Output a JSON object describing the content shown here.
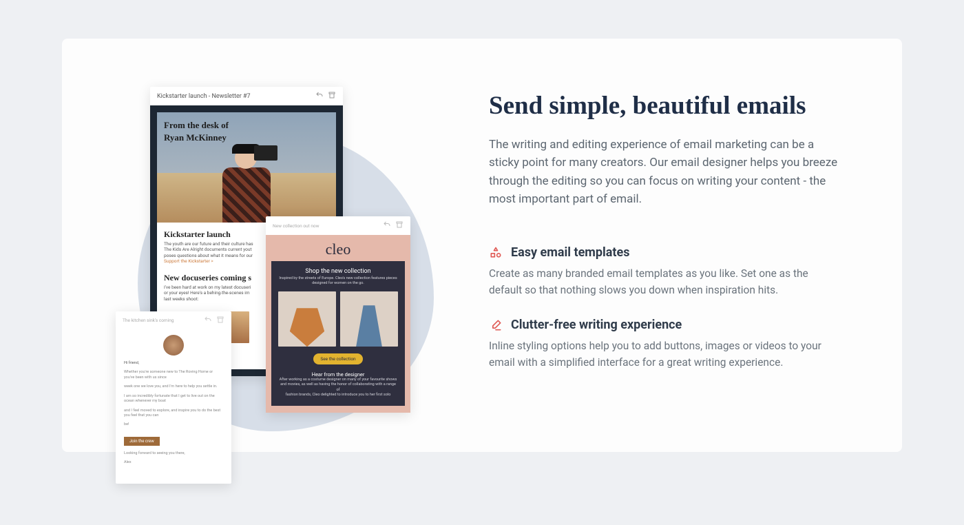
{
  "heading": "Send simple, beautiful emails",
  "lead": "The writing and editing experience of email marketing can be a sticky point for many creators. Our email designer helps you breeze through the editing so you can focus on writing your content - the most important part of email.",
  "features": [
    {
      "title": "Easy email templates",
      "body": "Create as many branded email templates as you like. Set one as the default so that nothing slows you down when inspiration hits."
    },
    {
      "title": "Clutter-free writing experience",
      "body": "Inline styling options help you to add buttons, images or videos to your email with a simplified interface for a great writing experience."
    }
  ],
  "mock1": {
    "tab": "Kickstarter launch - Newsletter #7",
    "hero_line1": "From the desk of",
    "hero_line2": "Ryan McKinney",
    "h1": "Kickstarter launch",
    "p1": "The youth are our future and their culture has",
    "p2": "The Kids Are Alright documents current yout",
    "p3": "poses questions about what it means for our",
    "link": "Support the Kickstarter >",
    "h2": "New docuseries coming s",
    "p4": "I've been hard at work on my latest docuseri",
    "p5": "or your eyes! Here's a behing-the-scenes im",
    "p6": "last weeks shoot:"
  },
  "mock2": {
    "tab": "New collection out now",
    "brand": "cleo",
    "title": "Shop the new collection",
    "sub1": "Inspired by the streets of Europe. Cleo's new collection features pieces",
    "sub2": "designed for women on the go.",
    "cta": "See the collection",
    "footer_title": "Hear from the designer",
    "footer_p1": "After working as a costume designer on many of your favourite shows",
    "footer_p2": "and movies, as well as having the honor of collaborating with a range of",
    "footer_p3": "fashion brands, Cleo delighted to introduce you to her first solo"
  },
  "mock3": {
    "tab": "The kitchen sink's coming",
    "greeting": "Hi friend,",
    "p1": "Whether you're someone new to The Roving Home or you've been with us since",
    "p2": "week one we love you, and I'm here to help you settle in.",
    "p3": "I am so incredibly fortunate that I get to live out on the ocean whenever my boat",
    "p4": "and I feel moved to explore, and inspire you to do the best you feel that you can",
    "p5": "be!",
    "btn": "Join the crew",
    "closing": "Looking forward to seeing you there,",
    "sig": "Alex"
  }
}
